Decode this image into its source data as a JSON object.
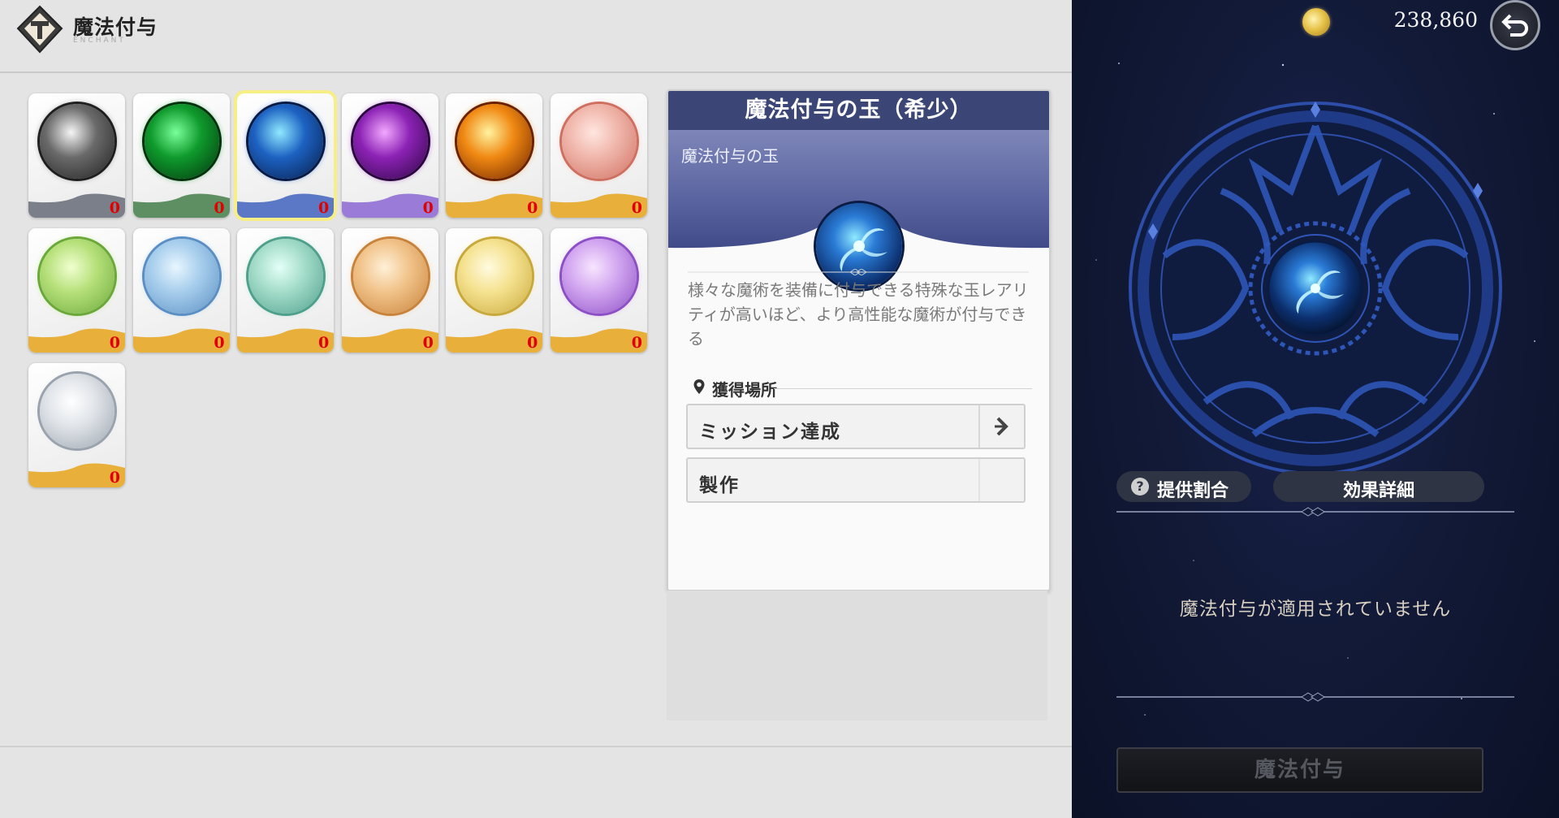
{
  "header": {
    "title": "魔法付与",
    "subtitle": "ENCHANT"
  },
  "orbs": [
    {
      "count": "0",
      "name": "orb-gray",
      "colors": [
        "#f5f5f5",
        "#6a6a6a",
        "#1f1f1f"
      ],
      "base": "#7a7f89"
    },
    {
      "count": "0",
      "name": "orb-green",
      "colors": [
        "#7aff9a",
        "#0f9a2d",
        "#03330d"
      ],
      "base": "#5e8f62"
    },
    {
      "count": "0",
      "name": "orb-blue",
      "colors": [
        "#8fe9ff",
        "#1d62c2",
        "#071b46"
      ],
      "base": "#5a78c6"
    },
    {
      "count": "0",
      "name": "orb-purple",
      "colors": [
        "#f2a8ff",
        "#8c22b5",
        "#2c0640"
      ],
      "base": "#9a7bd8"
    },
    {
      "count": "0",
      "name": "orb-orange",
      "colors": [
        "#fff3a0",
        "#f08812",
        "#6b2200"
      ],
      "base": "#e8b03a"
    },
    {
      "count": "0",
      "name": "orb-red-gem",
      "colors": [
        "#ffe6e0",
        "#f0b6ab",
        "#cf6f60"
      ],
      "base": "#e8b03a"
    },
    {
      "count": "0",
      "name": "orb-green-gem",
      "colors": [
        "#f0ffd0",
        "#b6e07a",
        "#6aa83a"
      ],
      "base": "#e8b03a"
    },
    {
      "count": "0",
      "name": "orb-blue-gem",
      "colors": [
        "#e8f6ff",
        "#a6cdec",
        "#5b8fc3"
      ],
      "base": "#e8b03a"
    },
    {
      "count": "0",
      "name": "orb-teal-gem",
      "colors": [
        "#e4fff7",
        "#a3dcc9",
        "#4e9f8c"
      ],
      "base": "#e8b03a"
    },
    {
      "count": "0",
      "name": "orb-amber-gem",
      "colors": [
        "#fff0d8",
        "#f1c38a",
        "#c8823a"
      ],
      "base": "#e8b03a"
    },
    {
      "count": "0",
      "name": "orb-yellow-gem",
      "colors": [
        "#fffbe0",
        "#f5e290",
        "#c8a83a"
      ],
      "base": "#e8b03a"
    },
    {
      "count": "0",
      "name": "orb-violet-gem",
      "colors": [
        "#f8e6ff",
        "#d2a6f0",
        "#8d4fc5"
      ],
      "base": "#e8b03a"
    },
    {
      "count": "0",
      "name": "orb-white-gem",
      "colors": [
        "#ffffff",
        "#dfe3e8",
        "#9aa3ad"
      ],
      "base": "#e8b03a"
    }
  ],
  "selected_index": 2,
  "detail": {
    "title": "魔法付与の玉（希少）",
    "banner_label": "魔法付与の玉",
    "description": "様々な魔術を装備に付与できる特殊な玉レアリティが高いほど、より高性能な魔術が付与できる",
    "acquisition_title": "獲得場所",
    "sources": [
      {
        "label": "ミッション達成",
        "has_arrow": true
      },
      {
        "label": "製作",
        "has_arrow": false
      }
    ]
  },
  "right": {
    "gold_icon": "gold-coin-icon",
    "gold_amount": "238,860",
    "back_icon": "back-arrow-icon",
    "ratio_button": "提供割合",
    "effect_button": "効果詳細",
    "status": "魔法付与が適用されていません",
    "enchant_button": "魔法付与"
  }
}
